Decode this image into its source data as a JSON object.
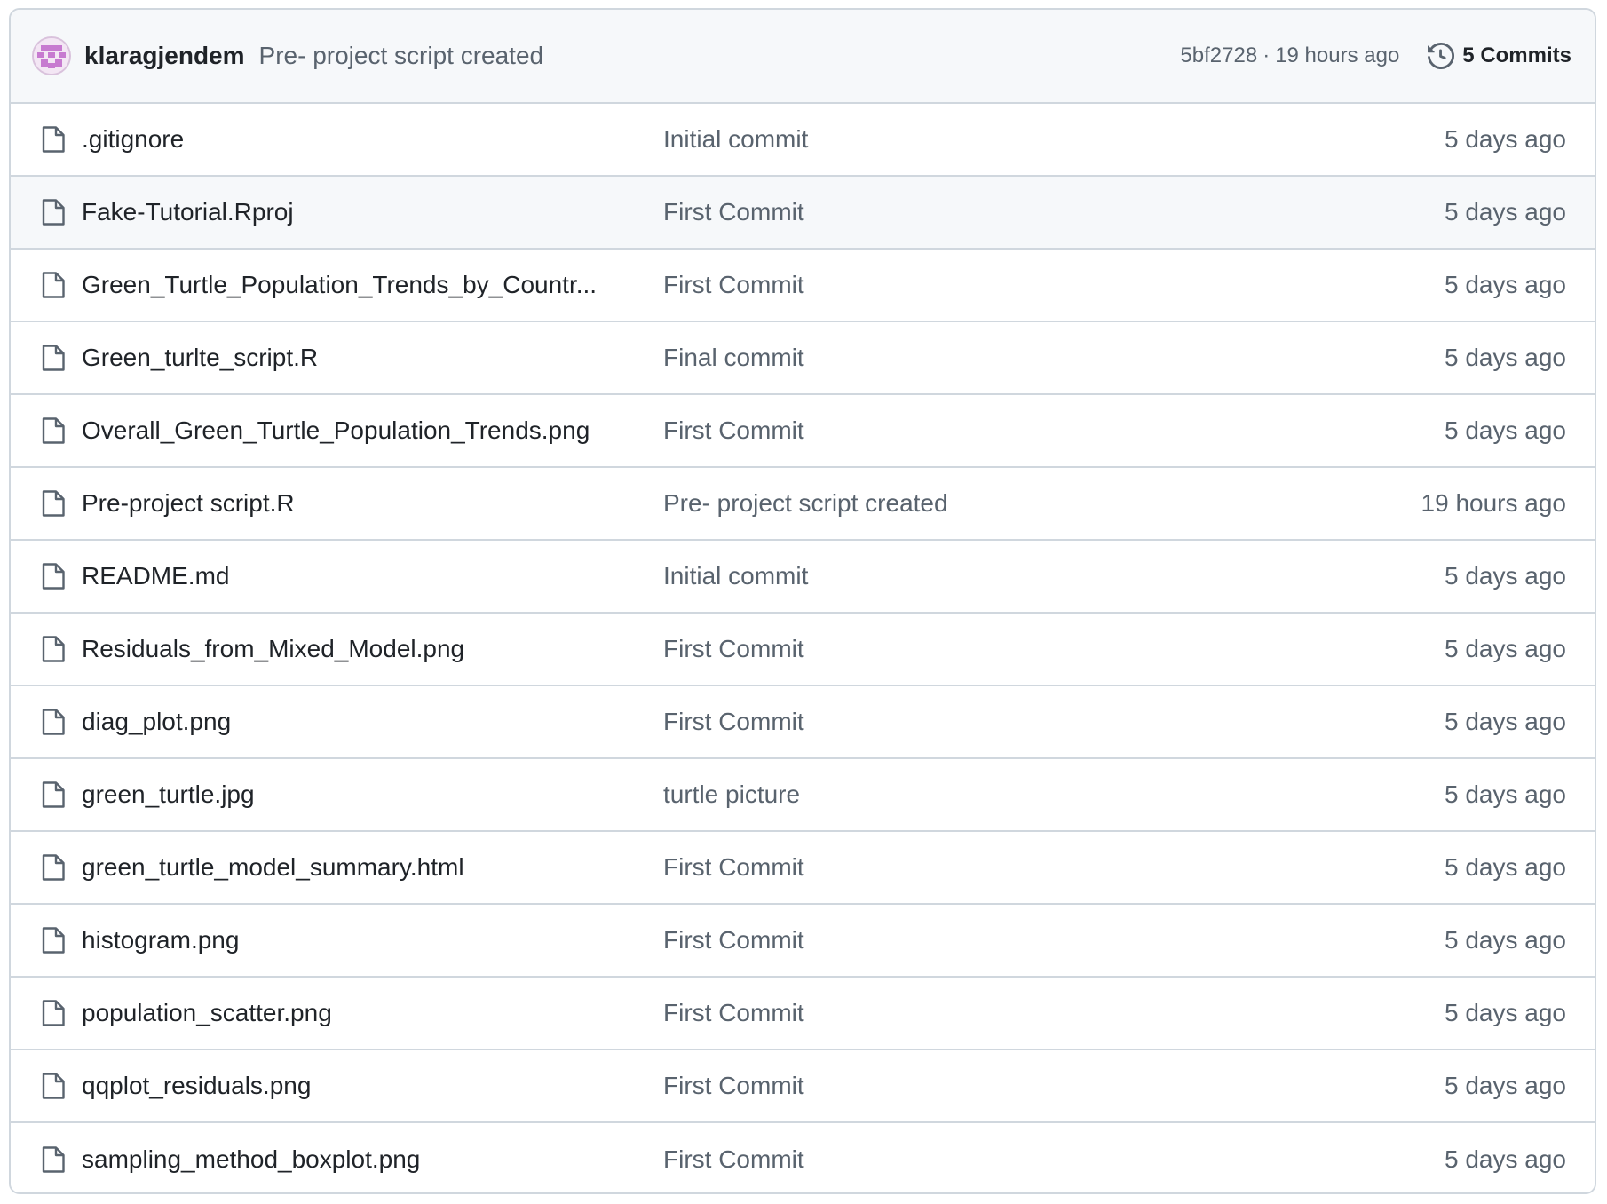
{
  "latest_commit": {
    "author": "klaragjendem",
    "message": "Pre- project script created",
    "sha": "5bf2728",
    "separator": "·",
    "age": "19 hours ago",
    "commits_label": "5 Commits",
    "avatar_icon": "identicon-avatar",
    "history_icon": "history-clock-icon"
  },
  "colors": {
    "border": "#d0d7de",
    "header_bg": "#f6f8fa",
    "muted_text": "#59636e",
    "primary_text": "#1f2328",
    "avatar_accent": "#c77ad0"
  },
  "files": [
    {
      "name": ".gitignore",
      "commit": "Initial commit",
      "age": "5 days ago",
      "icon": "file-icon"
    },
    {
      "name": "Fake-Tutorial.Rproj",
      "commit": "First Commit",
      "age": "5 days ago",
      "icon": "file-icon"
    },
    {
      "name": "Green_Turtle_Population_Trends_by_Countr...",
      "commit": "First Commit",
      "age": "5 days ago",
      "icon": "file-icon"
    },
    {
      "name": "Green_turlte_script.R",
      "commit": "Final commit",
      "age": "5 days ago",
      "icon": "file-icon"
    },
    {
      "name": "Overall_Green_Turtle_Population_Trends.png",
      "commit": "First Commit",
      "age": "5 days ago",
      "icon": "file-icon"
    },
    {
      "name": "Pre-project script.R",
      "commit": "Pre- project script created",
      "age": "19 hours ago",
      "icon": "file-icon"
    },
    {
      "name": "README.md",
      "commit": "Initial commit",
      "age": "5 days ago",
      "icon": "file-icon"
    },
    {
      "name": "Residuals_from_Mixed_Model.png",
      "commit": "First Commit",
      "age": "5 days ago",
      "icon": "file-icon"
    },
    {
      "name": "diag_plot.png",
      "commit": "First Commit",
      "age": "5 days ago",
      "icon": "file-icon"
    },
    {
      "name": "green_turtle.jpg",
      "commit": "turtle picture",
      "age": "5 days ago",
      "icon": "file-icon"
    },
    {
      "name": "green_turtle_model_summary.html",
      "commit": "First Commit",
      "age": "5 days ago",
      "icon": "file-icon"
    },
    {
      "name": "histogram.png",
      "commit": "First Commit",
      "age": "5 days ago",
      "icon": "file-icon"
    },
    {
      "name": "population_scatter.png",
      "commit": "First Commit",
      "age": "5 days ago",
      "icon": "file-icon"
    },
    {
      "name": "qqplot_residuals.png",
      "commit": "First Commit",
      "age": "5 days ago",
      "icon": "file-icon"
    },
    {
      "name": "sampling_method_boxplot.png",
      "commit": "First Commit",
      "age": "5 days ago",
      "icon": "file-icon"
    }
  ]
}
